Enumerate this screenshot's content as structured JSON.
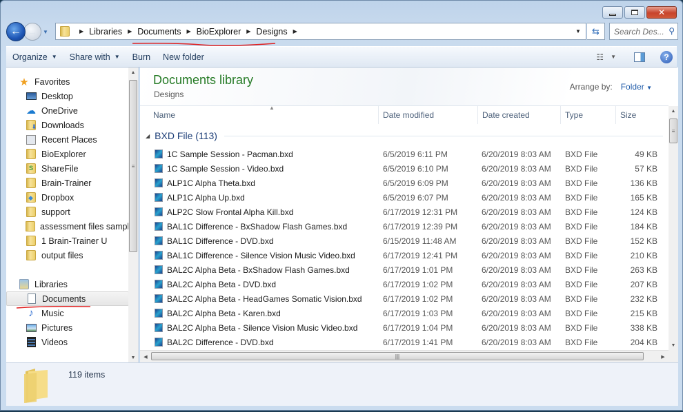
{
  "window": {
    "caption_buttons": {
      "minimize": "minimize",
      "maximize": "maximize",
      "close": "✕"
    }
  },
  "address_bar": {
    "breadcrumbs": [
      "Libraries",
      "Documents",
      "BioExplorer",
      "Designs"
    ],
    "search_placeholder": "Search Des...",
    "annotation_color": "#e02020"
  },
  "toolbar": {
    "organize": "Organize",
    "share_with": "Share with",
    "burn": "Burn",
    "new_folder": "New folder"
  },
  "nav": {
    "favorites_label": "Favorites",
    "favorites": [
      {
        "label": "Desktop",
        "icon": "desktop-icon"
      },
      {
        "label": "OneDrive",
        "icon": "onedrive-icon"
      },
      {
        "label": "Downloads",
        "icon": "downloads-icon"
      },
      {
        "label": "Recent Places",
        "icon": "recent-places-icon"
      },
      {
        "label": "BioExplorer",
        "icon": "folder-icon"
      },
      {
        "label": "ShareFile",
        "icon": "sharefile-icon"
      },
      {
        "label": "Brain-Trainer",
        "icon": "folder-icon"
      },
      {
        "label": "Dropbox",
        "icon": "dropbox-icon"
      },
      {
        "label": "support",
        "icon": "folder-icon"
      },
      {
        "label": "assessment files sample",
        "icon": "folder-icon"
      },
      {
        "label": "1 Brain-Trainer U",
        "icon": "folder-icon"
      },
      {
        "label": "output files",
        "icon": "folder-icon"
      }
    ],
    "libraries_label": "Libraries",
    "libraries": [
      {
        "label": "Documents",
        "icon": "documents-icon",
        "selected": true
      },
      {
        "label": "Music",
        "icon": "music-icon"
      },
      {
        "label": "Pictures",
        "icon": "pictures-icon"
      },
      {
        "label": "Videos",
        "icon": "videos-icon"
      }
    ]
  },
  "content": {
    "title": "Documents library",
    "subtitle": "Designs",
    "arrange_label": "Arrange by:",
    "arrange_value": "Folder",
    "title_color": "#267b26",
    "columns": [
      "Name",
      "Date modified",
      "Date created",
      "Type",
      "Size"
    ],
    "group_label": "BXD File (113)",
    "files": [
      {
        "name": "1C Sample Session - Pacman.bxd",
        "modified": "6/5/2019 6:11 PM",
        "created": "6/20/2019 8:03 AM",
        "type": "BXD File",
        "size": "49 KB"
      },
      {
        "name": "1C Sample Session - Video.bxd",
        "modified": "6/5/2019 6:10 PM",
        "created": "6/20/2019 8:03 AM",
        "type": "BXD File",
        "size": "57 KB"
      },
      {
        "name": "ALP1C Alpha Theta.bxd",
        "modified": "6/5/2019 6:09 PM",
        "created": "6/20/2019 8:03 AM",
        "type": "BXD File",
        "size": "136 KB"
      },
      {
        "name": "ALP1C Alpha Up.bxd",
        "modified": "6/5/2019 6:07 PM",
        "created": "6/20/2019 8:03 AM",
        "type": "BXD File",
        "size": "165 KB"
      },
      {
        "name": "ALP2C Slow Frontal Alpha Kill.bxd",
        "modified": "6/17/2019 12:31 PM",
        "created": "6/20/2019 8:03 AM",
        "type": "BXD File",
        "size": "124 KB"
      },
      {
        "name": "BAL1C Difference - BxShadow Flash Games.bxd",
        "modified": "6/17/2019 12:39 PM",
        "created": "6/20/2019 8:03 AM",
        "type": "BXD File",
        "size": "184 KB"
      },
      {
        "name": "BAL1C Difference - DVD.bxd",
        "modified": "6/15/2019 11:48 AM",
        "created": "6/20/2019 8:03 AM",
        "type": "BXD File",
        "size": "152 KB"
      },
      {
        "name": "BAL1C Difference - Silence Vision Music Video.bxd",
        "modified": "6/17/2019 12:41 PM",
        "created": "6/20/2019 8:03 AM",
        "type": "BXD File",
        "size": "210 KB"
      },
      {
        "name": "BAL2C Alpha Beta - BxShadow Flash Games.bxd",
        "modified": "6/17/2019 1:01 PM",
        "created": "6/20/2019 8:03 AM",
        "type": "BXD File",
        "size": "263 KB"
      },
      {
        "name": "BAL2C Alpha Beta - DVD.bxd",
        "modified": "6/17/2019 1:02 PM",
        "created": "6/20/2019 8:03 AM",
        "type": "BXD File",
        "size": "207 KB"
      },
      {
        "name": "BAL2C Alpha Beta - HeadGames Somatic Vision.bxd",
        "modified": "6/17/2019 1:02 PM",
        "created": "6/20/2019 8:03 AM",
        "type": "BXD File",
        "size": "232 KB"
      },
      {
        "name": "BAL2C Alpha Beta - Karen.bxd",
        "modified": "6/17/2019 1:03 PM",
        "created": "6/20/2019 8:03 AM",
        "type": "BXD File",
        "size": "215 KB"
      },
      {
        "name": "BAL2C Alpha Beta - Silence Vision Music Video.bxd",
        "modified": "6/17/2019 1:04 PM",
        "created": "6/20/2019 8:03 AM",
        "type": "BXD File",
        "size": "338 KB"
      },
      {
        "name": "BAL2C Difference - DVD.bxd",
        "modified": "6/17/2019 1:41 PM",
        "created": "6/20/2019 8:03 AM",
        "type": "BXD File",
        "size": "204 KB"
      }
    ]
  },
  "details": {
    "item_count": "119 items"
  }
}
